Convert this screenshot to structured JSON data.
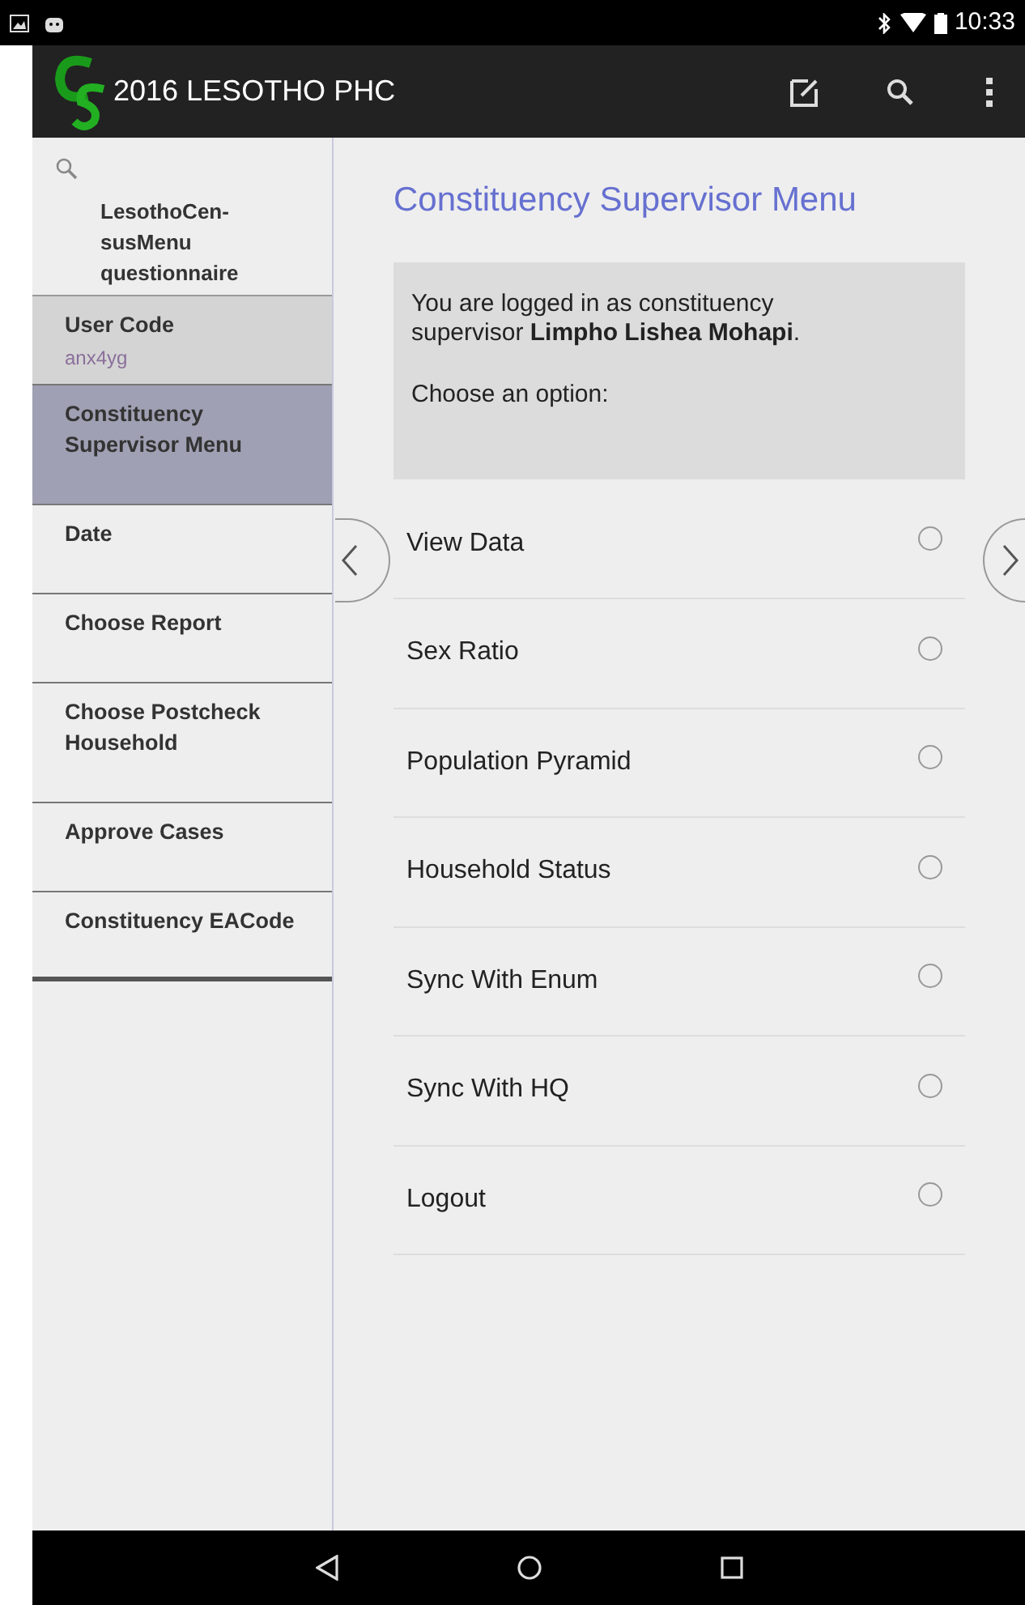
{
  "status_bar": {
    "time": "10:33"
  },
  "app_bar": {
    "title": "2016 LESOTHO PHC"
  },
  "sidebar": {
    "questionnaire": "LesothoCen-\nsusMenu\nquestionnaire",
    "items": [
      {
        "kind": "field",
        "label": "User Code",
        "value": "anx4yg",
        "selected": false
      },
      {
        "kind": "item",
        "label": "Constituency Supervisor Menu",
        "selected": true
      },
      {
        "kind": "item",
        "label": "Date",
        "selected": false
      },
      {
        "kind": "item",
        "label": "Choose Report",
        "selected": false
      },
      {
        "kind": "item",
        "label": "Choose Postcheck Household",
        "selected": false
      },
      {
        "kind": "item",
        "label": "Approve Cases",
        "selected": false
      },
      {
        "kind": "item",
        "label": "Constituency EACode",
        "selected": false
      }
    ]
  },
  "content": {
    "title": "Constituency Supervisor Menu",
    "message": "You are logged in as constituency supervisor **Limpho Lishea Mohapi**.",
    "prompt": "Choose an option:",
    "options": [
      {
        "label": "View Data",
        "checked": false
      },
      {
        "label": "Sex Ratio",
        "checked": false
      },
      {
        "label": "Population Pyramid",
        "checked": false
      },
      {
        "label": "Household Status",
        "checked": false
      },
      {
        "label": "Sync With Enum",
        "checked": false
      },
      {
        "label": "Sync With HQ",
        "checked": false
      },
      {
        "label": "Logout",
        "checked": false
      }
    ]
  }
}
